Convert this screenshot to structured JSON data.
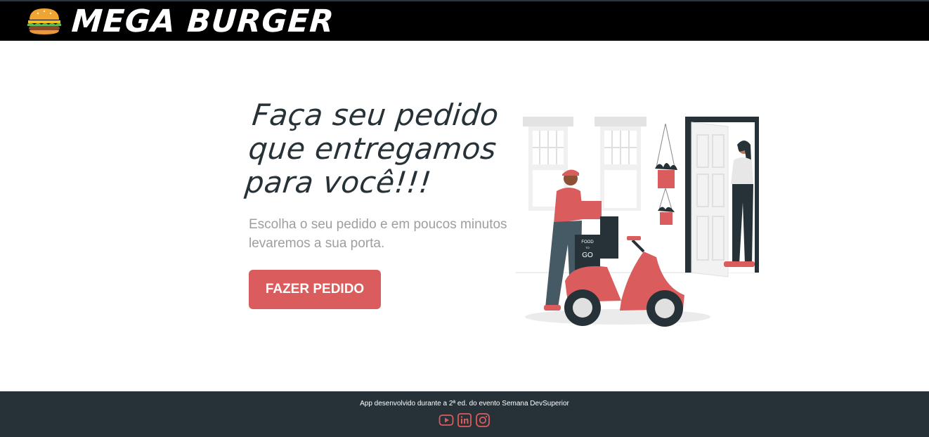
{
  "header": {
    "logo_icon": "burger-icon",
    "title": "MEGA BURGER"
  },
  "home": {
    "title_lines": [
      "Faça seu pedido",
      "que entregamos",
      "para você!!!"
    ],
    "subtitle_lines": [
      "Escolha o seu pedido e em poucos minutos",
      "levaremos a sua porta."
    ],
    "cta_label": "FAZER PEDIDO",
    "illustration": {
      "delivery_box_text": [
        "FOOD",
        "TO",
        "GO"
      ]
    }
  },
  "footer": {
    "text": "App desenvolvido durante a 2ª ed. do evento Semana DevSuperior",
    "icons": [
      "youtube-icon",
      "linkedin-icon",
      "instagram-icon"
    ]
  },
  "colors": {
    "header_bg": "#000000",
    "accent": "#da5c5c",
    "dark": "#263238",
    "subtitle": "#9e9e9e"
  }
}
